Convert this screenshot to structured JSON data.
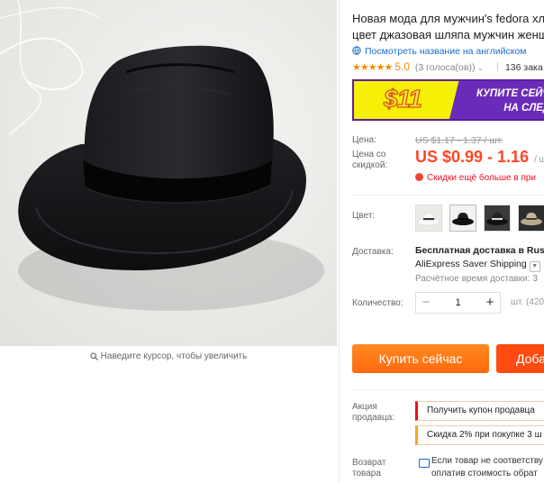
{
  "image": {
    "alt": "Black fedora hat",
    "zoom_hint": "Наведите курсор, чтобы увеличить"
  },
  "product": {
    "title_line1": "Новая мода для мужчин's fedora хло",
    "title_line2": "цвет джазовая шляпа мужчин женщ",
    "view_english": "Посмотреть название на английском",
    "stars": "★★★★★",
    "rating": "5.0",
    "votes": "(3 голоса(ов))",
    "orders": "136 зака"
  },
  "banner": {
    "price": "$11",
    "cta_line1": "КУПИТЕ СЕЙЧА",
    "cta_line2": "НА СЛЕДУ"
  },
  "price": {
    "label": "Цена:",
    "old": "US $1.17 - 1.37 / шт.",
    "discount_label_line1": "Цена со",
    "discount_label_line2": "скидкой:",
    "current": "US $0.99 - 1.16",
    "unit": "/ ш",
    "hot": "Скидки ещё больше в при"
  },
  "color": {
    "label": "Цвет:",
    "options": [
      "white-hat",
      "black-hat-light",
      "black-hat-dark",
      "khaki-hat"
    ]
  },
  "delivery": {
    "label": "Доставка:",
    "free": "Бесплатная доставка в Russ",
    "service": "AliExpress Saver Shipping",
    "estimate": "Расчётное время доставки: 3"
  },
  "quantity": {
    "label": "Количество:",
    "value": "1",
    "minus": "−",
    "plus": "+",
    "note": "шт. (420 ш"
  },
  "actions": {
    "buy_now": "Купить сейчас",
    "add_cart": "Доба"
  },
  "seller_promo": {
    "label_line1": "Акция",
    "label_line2": "продавца:",
    "coupon": "Получить купон продавца",
    "discount": "Скидка 2% при покупке 3 ш"
  },
  "returns": {
    "label_line1": "Возврат",
    "label_line2": "товара",
    "text_line1": "Если товар не соответству",
    "text_line2": "оплатив стоимость обрат"
  },
  "colors": {
    "accent": "#ff4726",
    "buy": "#ff7a18",
    "cart": "#ff4a10",
    "link": "#1a6dd0",
    "banner_bg": "#f5f005",
    "banner_purple": "#6a2bb8"
  }
}
